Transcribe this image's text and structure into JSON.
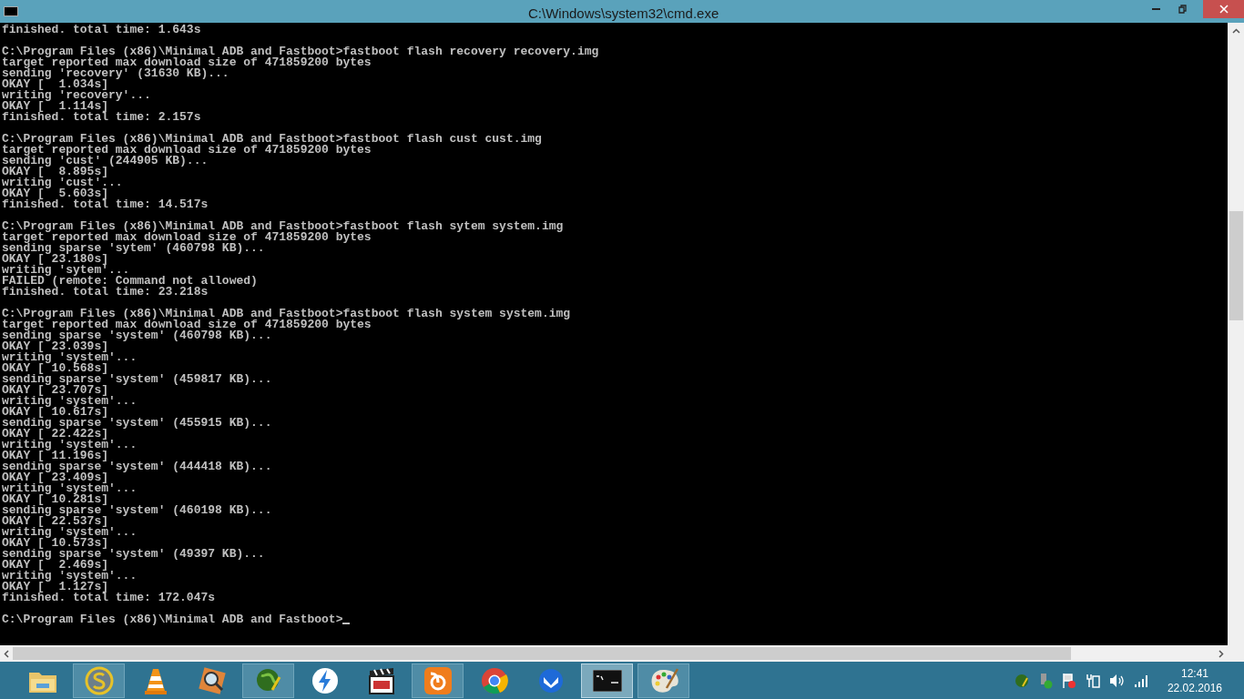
{
  "window": {
    "title": "C:\\Windows\\system32\\cmd.exe"
  },
  "console": {
    "blocks": [
      [
        "finished. total time: 1.643s"
      ],
      [
        "C:\\Program Files (x86)\\Minimal ADB and Fastboot>fastboot flash recovery recovery.img",
        "target reported max download size of 471859200 bytes",
        "sending 'recovery' (31630 KB)...",
        "OKAY [  1.034s]",
        "writing 'recovery'...",
        "OKAY [  1.114s]",
        "finished. total time: 2.157s"
      ],
      [
        "C:\\Program Files (x86)\\Minimal ADB and Fastboot>fastboot flash cust cust.img",
        "target reported max download size of 471859200 bytes",
        "sending 'cust' (244905 KB)...",
        "OKAY [  8.895s]",
        "writing 'cust'...",
        "OKAY [  5.603s]",
        "finished. total time: 14.517s"
      ],
      [
        "C:\\Program Files (x86)\\Minimal ADB and Fastboot>fastboot flash sytem system.img",
        "target reported max download size of 471859200 bytes",
        "sending sparse 'sytem' (460798 KB)...",
        "OKAY [ 23.180s]",
        "writing 'sytem'...",
        "FAILED (remote: Command not allowed)",
        "finished. total time: 23.218s"
      ],
      [
        "C:\\Program Files (x86)\\Minimal ADB and Fastboot>fastboot flash system system.img",
        "target reported max download size of 471859200 bytes",
        "sending sparse 'system' (460798 KB)...",
        "OKAY [ 23.039s]",
        "writing 'system'...",
        "OKAY [ 10.568s]",
        "sending sparse 'system' (459817 KB)...",
        "OKAY [ 23.707s]",
        "writing 'system'...",
        "OKAY [ 10.617s]",
        "sending sparse 'system' (455915 KB)...",
        "OKAY [ 22.422s]",
        "writing 'system'...",
        "OKAY [ 11.196s]",
        "sending sparse 'system' (444418 KB)...",
        "OKAY [ 23.409s]",
        "writing 'system'...",
        "OKAY [ 10.281s]",
        "sending sparse 'system' (460198 KB)...",
        "OKAY [ 22.537s]",
        "writing 'system'...",
        "OKAY [ 10.573s]",
        "sending sparse 'system' (49397 KB)...",
        "OKAY [  2.469s]",
        "writing 'system'...",
        "OKAY [  1.127s]",
        "finished. total time: 172.047s"
      ]
    ],
    "prompt": "C:\\Program Files (x86)\\Minimal ADB and Fastboot>"
  },
  "taskbar": {
    "items": [
      {
        "running": false,
        "active": false
      },
      {
        "running": true,
        "active": false
      },
      {
        "running": false,
        "active": false
      },
      {
        "running": false,
        "active": false
      },
      {
        "running": true,
        "active": false
      },
      {
        "running": false,
        "active": false
      },
      {
        "running": false,
        "active": false
      },
      {
        "running": true,
        "active": false
      },
      {
        "running": false,
        "active": false
      },
      {
        "running": false,
        "active": false
      },
      {
        "running": true,
        "active": true
      },
      {
        "running": true,
        "active": false
      }
    ]
  },
  "clock": {
    "time": "12:41",
    "date": "22.02.2016"
  }
}
